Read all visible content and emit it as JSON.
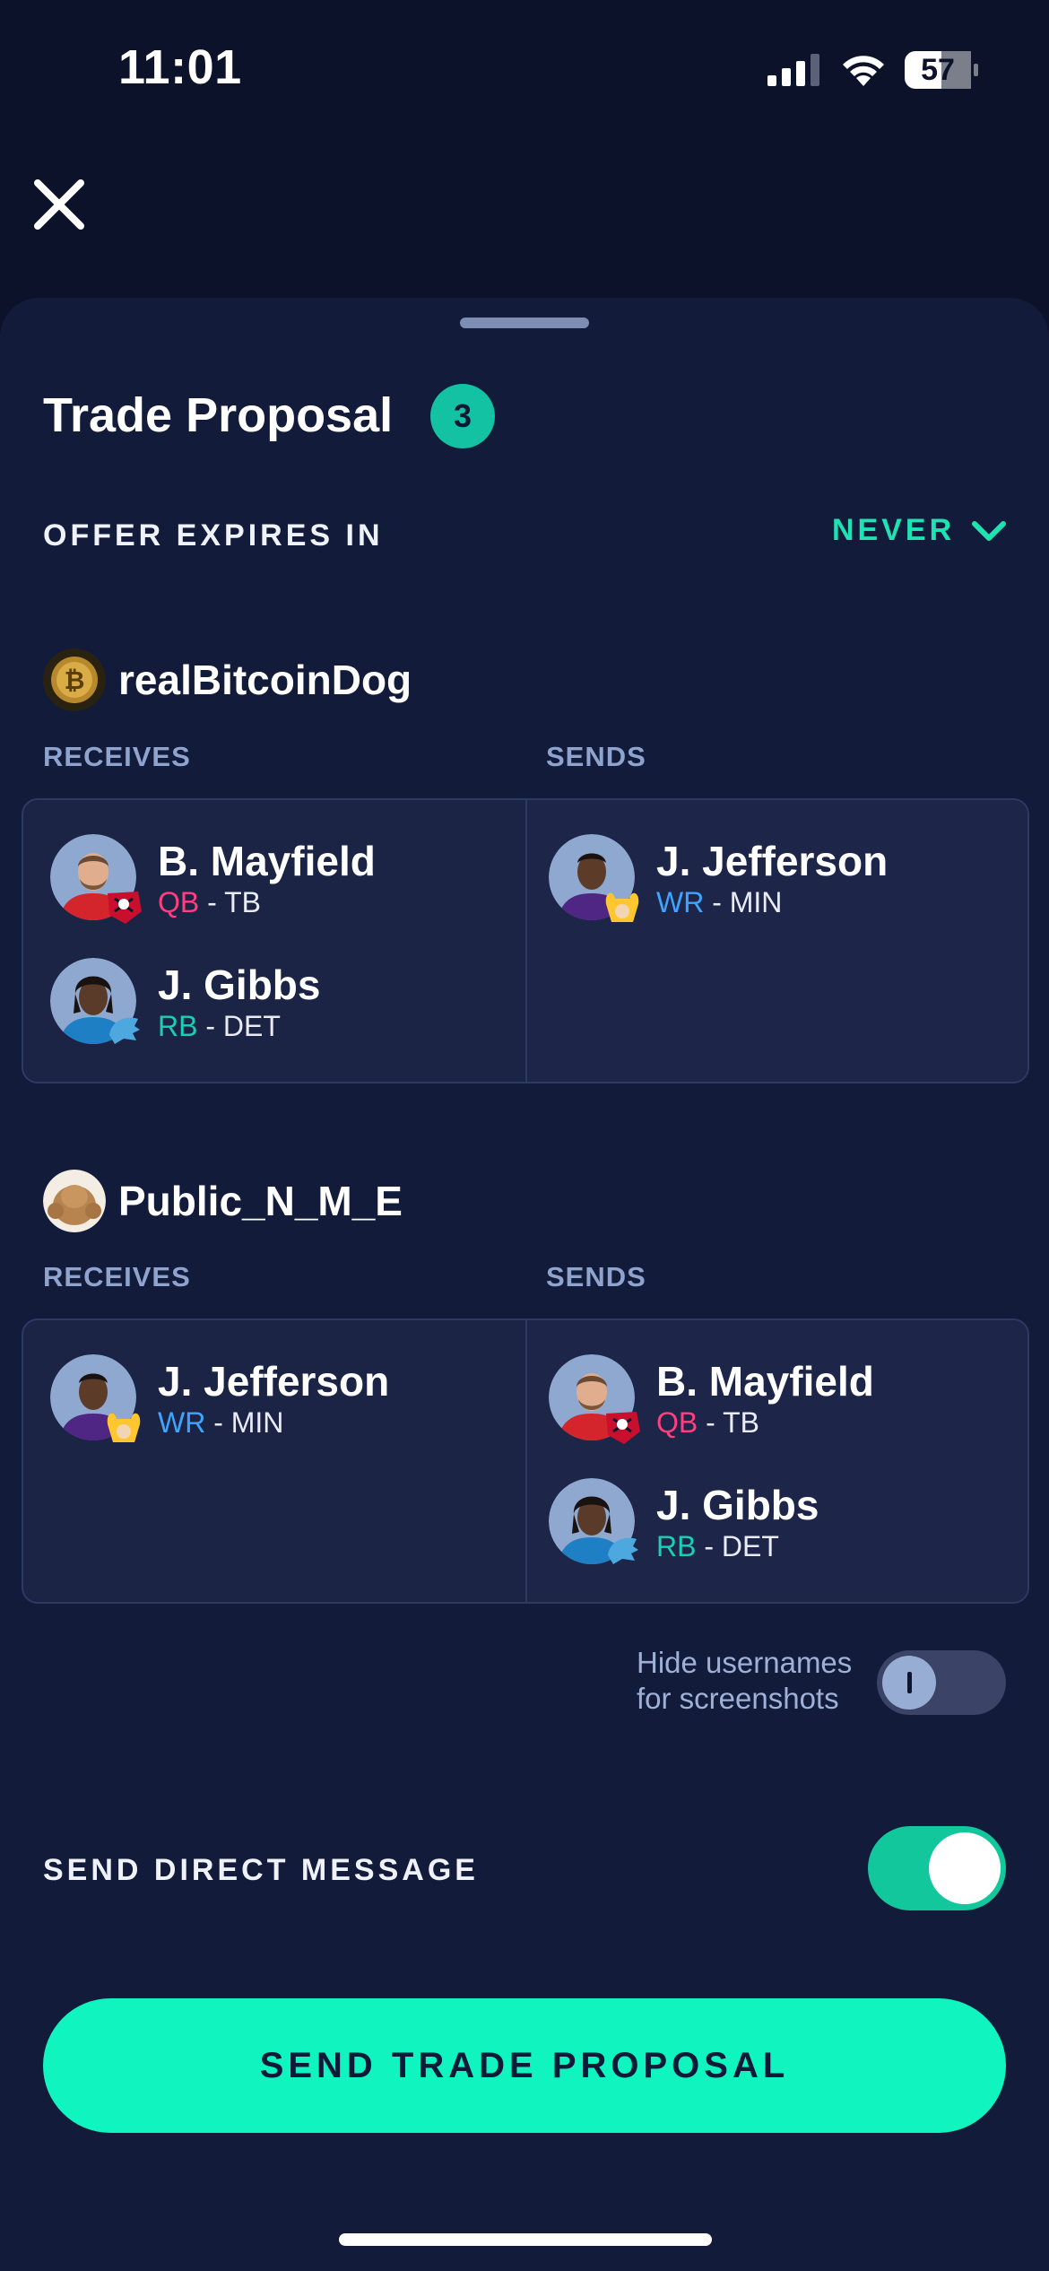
{
  "status_bar": {
    "time": "11:01",
    "battery": "57"
  },
  "header": {
    "title": "Trade Proposal",
    "count": "3"
  },
  "expires": {
    "label": "OFFER EXPIRES IN",
    "value": "NEVER"
  },
  "column_labels": {
    "receives": "RECEIVES",
    "sends": "SENDS"
  },
  "parties": [
    {
      "username": "realBitcoinDog",
      "receives": [
        {
          "name": "B. Mayfield",
          "position": "QB",
          "team": "- TB"
        },
        {
          "name": "J. Gibbs",
          "position": "RB",
          "team": "- DET"
        }
      ],
      "sends": [
        {
          "name": "J. Jefferson",
          "position": "WR",
          "team": "- MIN"
        }
      ]
    },
    {
      "username": "Public_N_M_E",
      "receives": [
        {
          "name": "J. Jefferson",
          "position": "WR",
          "team": "- MIN"
        }
      ],
      "sends": [
        {
          "name": "B. Mayfield",
          "position": "QB",
          "team": "- TB"
        },
        {
          "name": "J. Gibbs",
          "position": "RB",
          "team": "- DET"
        }
      ]
    }
  ],
  "hide_usernames": {
    "line1": "Hide usernames",
    "line2": "for screenshots",
    "enabled": false
  },
  "direct_message": {
    "label": "SEND DIRECT MESSAGE",
    "enabled": true
  },
  "submit": {
    "label": "SEND TRADE PROPOSAL"
  },
  "colors": {
    "accent": "#10f5c0",
    "qb": "#ff3f7f",
    "rb": "#19d0b5",
    "wr": "#3fa4ff",
    "background": "#0c1229",
    "sheet": "#131b3b"
  }
}
